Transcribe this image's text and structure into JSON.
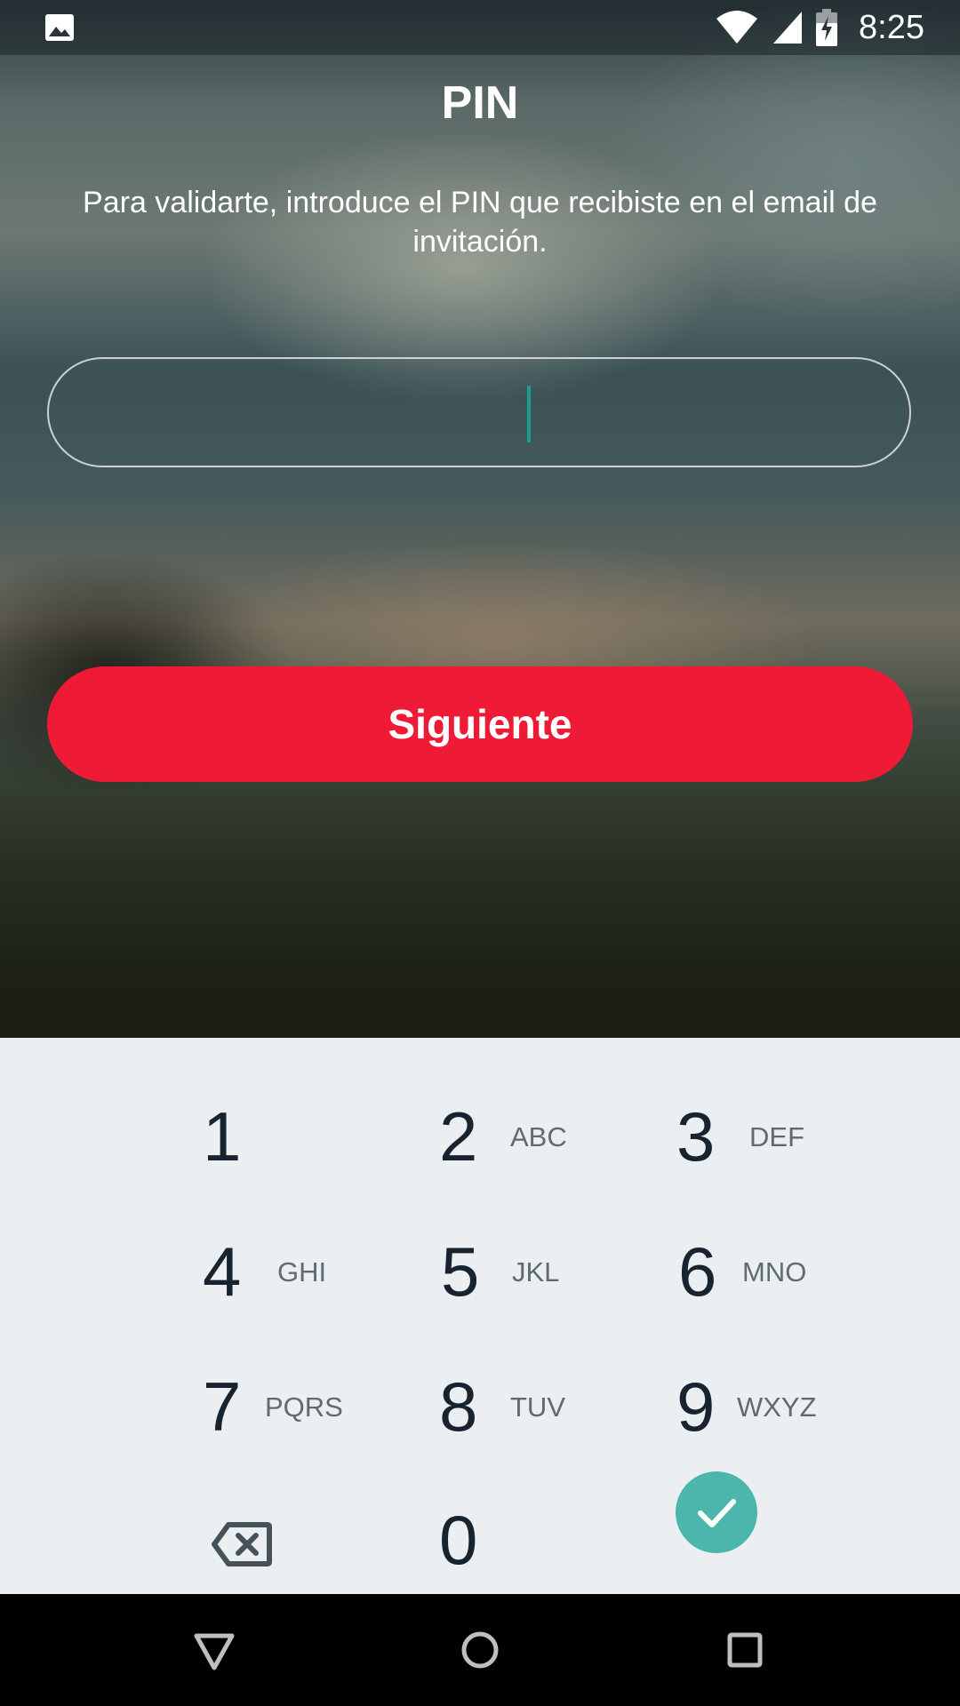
{
  "status_bar": {
    "time": "8:25",
    "icons": [
      "image-icon",
      "wifi-icon",
      "signal-icon",
      "battery-charging-icon"
    ]
  },
  "screen": {
    "title": "PIN",
    "instructions": "Para validarte, introduce el PIN que recibiste en el email de invitación.",
    "pin_value": "",
    "next_label": "Siguiente"
  },
  "colors": {
    "accent_red": "#ef1b36",
    "caret_teal": "#1a9c8e",
    "confirm_teal": "#4db6ac",
    "keypad_bg": "#eceff1"
  },
  "keypad": {
    "keys": [
      {
        "digit": "1",
        "letters": ""
      },
      {
        "digit": "2",
        "letters": "ABC"
      },
      {
        "digit": "3",
        "letters": "DEF"
      },
      {
        "digit": "4",
        "letters": "GHI"
      },
      {
        "digit": "5",
        "letters": "JKL"
      },
      {
        "digit": "6",
        "letters": "MNO"
      },
      {
        "digit": "7",
        "letters": "PQRS"
      },
      {
        "digit": "8",
        "letters": "TUV"
      },
      {
        "digit": "9",
        "letters": "WXYZ"
      },
      {
        "digit": "0",
        "letters": ""
      }
    ],
    "backspace_icon": "backspace-icon",
    "confirm_icon": "check-icon"
  },
  "nav_bar": {
    "icons": [
      "back-triangle-icon",
      "home-circle-icon",
      "recents-square-icon"
    ]
  }
}
